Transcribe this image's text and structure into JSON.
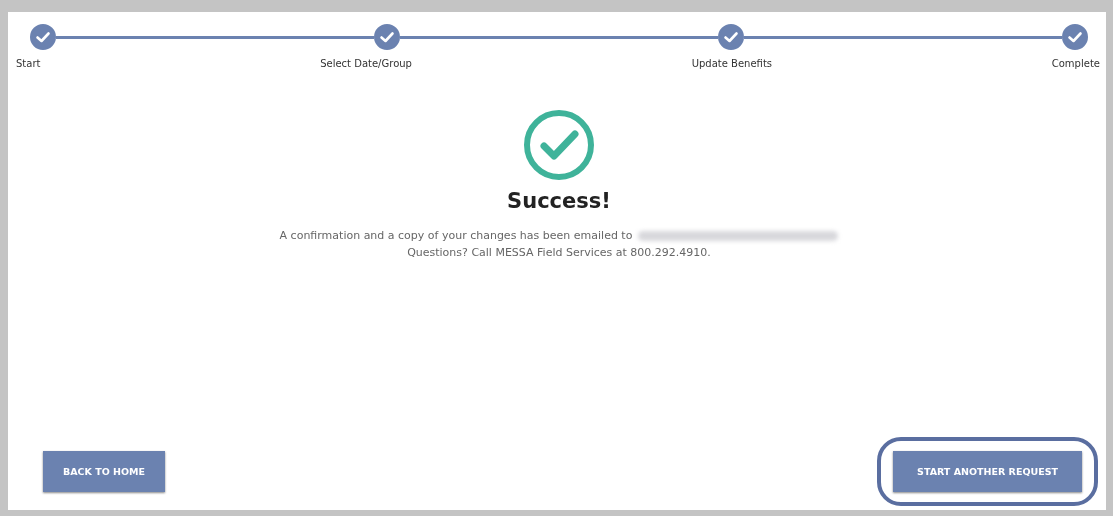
{
  "steps": [
    {
      "label": "Start",
      "completed": true
    },
    {
      "label": "Select Date/Group",
      "completed": true
    },
    {
      "label": "Update Benefits",
      "completed": true
    },
    {
      "label": "Complete",
      "completed": true
    }
  ],
  "result": {
    "title": "Success!",
    "message": "A confirmation and a copy of your changes has been emailed to",
    "email_redacted": true,
    "contact": "Questions? Call MESSA Field Services at 800.292.4910."
  },
  "buttons": [
    {
      "label": "BACK TO HOME",
      "highlighted": false
    },
    {
      "label": "START ANOTHER REQUEST",
      "highlighted": true
    }
  ]
}
